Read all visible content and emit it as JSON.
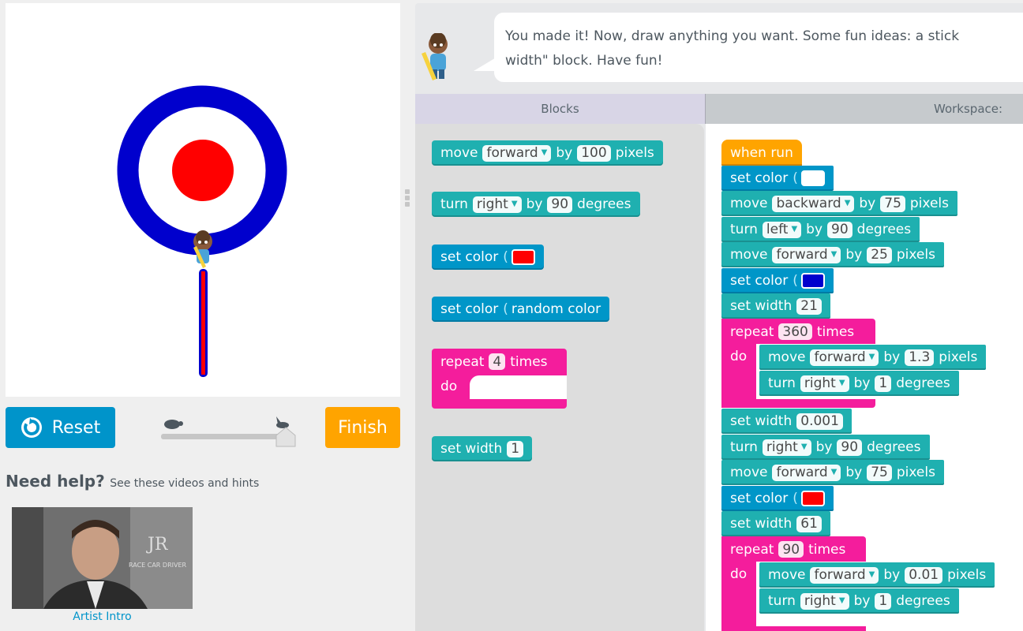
{
  "controls": {
    "reset_label": "Reset",
    "finish_label": "Finish"
  },
  "help": {
    "title": "Need help?",
    "subtitle": "See these videos and hints"
  },
  "video": {
    "caption": "Artist Intro",
    "overlay_initials": "JR",
    "overlay_sub": "RACE CAR DRIVER"
  },
  "instructions": {
    "line1": "You made it! Now, draw anything you want. Some fun ideas: a stick",
    "line2": "width\" block. Have fun!"
  },
  "tabs": {
    "blocks": "Blocks",
    "workspace": "Workspace:"
  },
  "colors": {
    "red": "#ff0000",
    "blue": "#0000cd",
    "white": "#ffffff",
    "teal": "#1fb0b0",
    "pink": "#f41d9c",
    "orange": "#ffa400",
    "reset_blue": "#0094ca"
  },
  "toolbox": {
    "move": {
      "verb": "move",
      "dir": "forward",
      "by": "by",
      "value": "100",
      "unit": "pixels"
    },
    "turn": {
      "verb": "turn",
      "dir": "right",
      "by": "by",
      "value": "90",
      "unit": "degrees"
    },
    "setcolor": {
      "label": "set color"
    },
    "setcolor_random": {
      "label": "set color",
      "value": "random color"
    },
    "repeat": {
      "verb": "repeat",
      "value": "4",
      "unit": "times",
      "do": "do"
    },
    "setwidth": {
      "label": "set width",
      "value": "1"
    }
  },
  "workspace": {
    "when_run": "when run",
    "b1": {
      "label": "set color"
    },
    "b2": {
      "verb": "move",
      "dir": "backward",
      "by": "by",
      "value": "75",
      "unit": "pixels"
    },
    "b3": {
      "verb": "turn",
      "dir": "left",
      "by": "by",
      "value": "90",
      "unit": "degrees"
    },
    "b4": {
      "verb": "move",
      "dir": "forward",
      "by": "by",
      "value": "25",
      "unit": "pixels"
    },
    "b5": {
      "label": "set color"
    },
    "b6": {
      "label": "set width",
      "value": "21"
    },
    "r1": {
      "verb": "repeat",
      "value": "360",
      "unit": "times",
      "do": "do",
      "move": {
        "verb": "move",
        "dir": "forward",
        "by": "by",
        "value": "1.3",
        "unit": "pixels"
      },
      "turn": {
        "verb": "turn",
        "dir": "right",
        "by": "by",
        "value": "1",
        "unit": "degrees"
      }
    },
    "b7": {
      "label": "set width",
      "value": "0.001"
    },
    "b8": {
      "verb": "turn",
      "dir": "right",
      "by": "by",
      "value": "90",
      "unit": "degrees"
    },
    "b9": {
      "verb": "move",
      "dir": "forward",
      "by": "by",
      "value": "75",
      "unit": "pixels"
    },
    "b10": {
      "label": "set color"
    },
    "b11": {
      "label": "set width",
      "value": "61"
    },
    "r2": {
      "verb": "repeat",
      "value": "90",
      "unit": "times",
      "do": "do",
      "move": {
        "verb": "move",
        "dir": "forward",
        "by": "by",
        "value": "0.01",
        "unit": "pixels"
      },
      "turn": {
        "verb": "turn",
        "dir": "right",
        "by": "by",
        "value": "1",
        "unit": "degrees"
      }
    }
  }
}
